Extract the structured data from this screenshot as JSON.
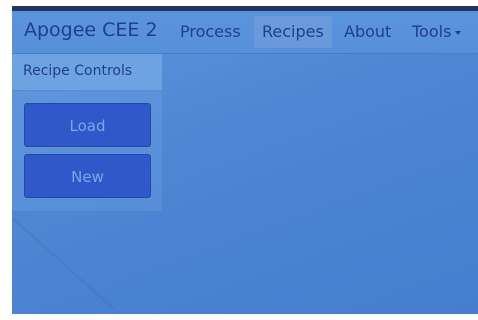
{
  "navbar": {
    "brand": "Apogee CEE 2",
    "items": [
      {
        "label": "Process",
        "active": false
      },
      {
        "label": "Recipes",
        "active": true
      },
      {
        "label": "About",
        "active": false
      },
      {
        "label": "Tools",
        "active": false
      }
    ]
  },
  "sidebar": {
    "heading": "Recipe Controls",
    "buttons": {
      "load_label": "Load",
      "new_label": "New"
    }
  },
  "colors": {
    "screen_bg": "#4f87d4",
    "navbar_text": "#1f3f8c",
    "button_bg": "#2f58c8",
    "button_text": "#7fa6e6"
  }
}
